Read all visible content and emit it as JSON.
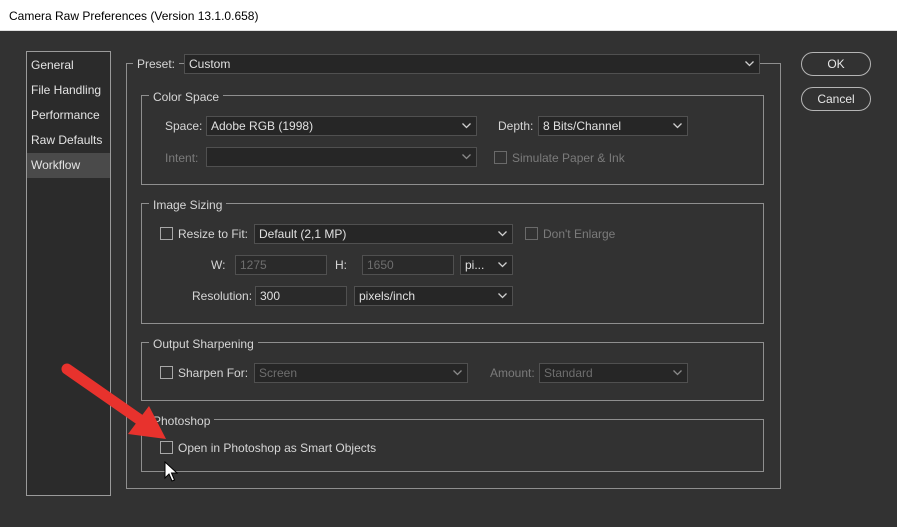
{
  "window": {
    "title": "Camera Raw Preferences  (Version 13.1.0.658)"
  },
  "sidebar": {
    "items": [
      {
        "label": "General"
      },
      {
        "label": "File Handling"
      },
      {
        "label": "Performance"
      },
      {
        "label": "Raw Defaults"
      },
      {
        "label": "Workflow",
        "selected": true
      }
    ]
  },
  "preset": {
    "label": "Preset:",
    "value": "Custom"
  },
  "buttons": {
    "ok": "OK",
    "cancel": "Cancel"
  },
  "color_space": {
    "title": "Color Space",
    "space_label": "Space:",
    "space_value": "Adobe RGB (1998)",
    "depth_label": "Depth:",
    "depth_value": "8 Bits/Channel",
    "intent_label": "Intent:",
    "intent_value": "",
    "simulate_label": "Simulate Paper & Ink"
  },
  "image_sizing": {
    "title": "Image Sizing",
    "resize_label": "Resize to Fit:",
    "resize_value": "Default  (2,1 MP)",
    "dont_enlarge_label": "Don't Enlarge",
    "w_label": "W:",
    "w_value": "1275",
    "h_label": "H:",
    "h_value": "1650",
    "unit_value": "pi...",
    "resolution_label": "Resolution:",
    "resolution_value": "300",
    "resolution_unit": "pixels/inch"
  },
  "output_sharpening": {
    "title": "Output Sharpening",
    "sharpen_label": "Sharpen For:",
    "sharpen_value": "Screen",
    "amount_label": "Amount:",
    "amount_value": "Standard"
  },
  "photoshop": {
    "title": "Photoshop",
    "smart_objects_label": "Open in Photoshop as Smart Objects"
  },
  "colors": {
    "background": "#323232",
    "arrow": "#e8322d"
  },
  "icons": {
    "caret": "chevron-down-icon",
    "cursor": "mouse-pointer-icon",
    "annotation": "red-arrow-icon"
  }
}
